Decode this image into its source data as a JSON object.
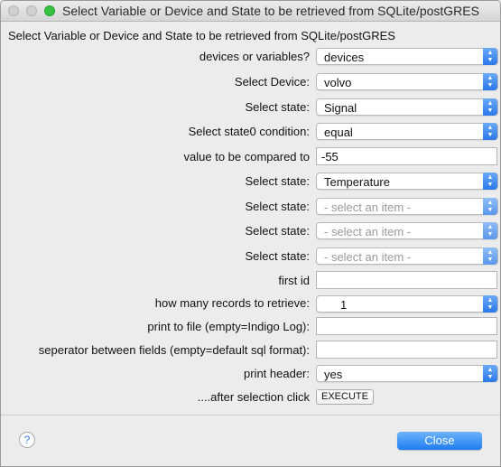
{
  "window": {
    "title": "Select Variable or Device and State to be retrieved from SQLite/postGRES",
    "heading": "Select Variable  or  Device and State to be retrieved from SQLite/postGRES"
  },
  "form": {
    "devices_or_variables": {
      "label": "devices or variables?",
      "value": "devices"
    },
    "device": {
      "label": "Select  Device:",
      "value": "volvo"
    },
    "state0": {
      "label": "Select state:",
      "value": "Signal"
    },
    "state0_condition": {
      "label": "Select state0 condition:",
      "value": "equal"
    },
    "compare_value": {
      "label": "value to be compared to",
      "value": "-55"
    },
    "state1": {
      "label": "Select state:",
      "value": "Temperature"
    },
    "state2": {
      "label": "Select state:",
      "value": "- select an item -"
    },
    "state3": {
      "label": "Select state:",
      "value": "- select an item -"
    },
    "state4": {
      "label": "Select state:",
      "value": "- select an item -"
    },
    "first_id": {
      "label": "first id",
      "value": ""
    },
    "records": {
      "label": "how many records to retrieve:",
      "value": "1"
    },
    "print_file": {
      "label": "print to file (empty=Indigo Log):",
      "value": ""
    },
    "separator": {
      "label": "seperator between fields (empty=default sql format):",
      "value": ""
    },
    "print_header": {
      "label": "print header:",
      "value": "yes"
    },
    "execute": {
      "label": "....after selection click",
      "button": "EXECUTE"
    }
  },
  "footer": {
    "help": "?",
    "close": "Close"
  },
  "colors": {
    "accent": "#2a78e9",
    "zoom_light": "#35c242"
  }
}
